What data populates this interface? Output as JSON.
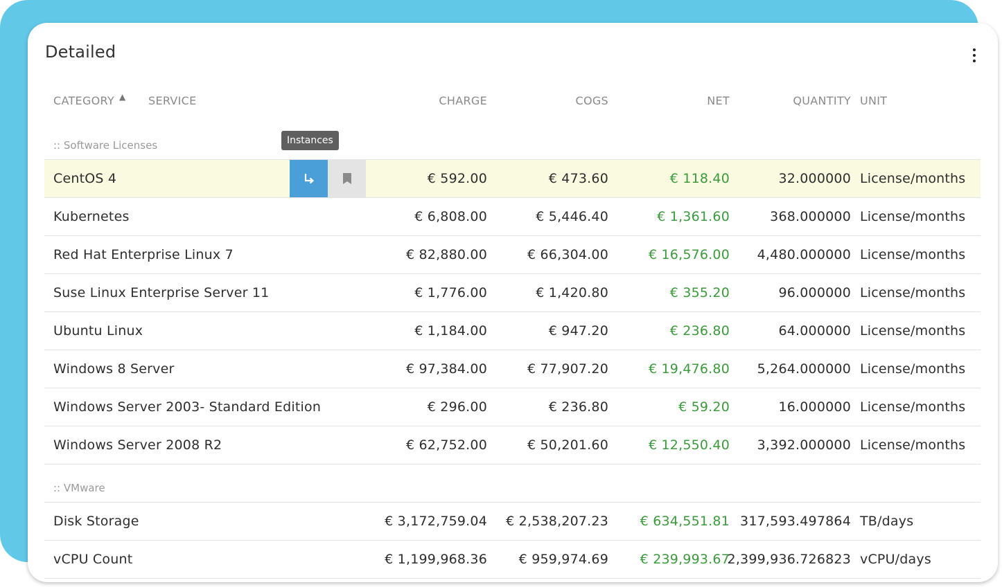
{
  "card": {
    "title": "Detailed"
  },
  "columns": {
    "category": "CATEGORY",
    "service": "SERVICE",
    "charge": "CHARGE",
    "cogs": "COGS",
    "net": "NET",
    "quantity": "QUANTITY",
    "unit": "UNIT"
  },
  "sort": {
    "column": "category",
    "direction": "ascending",
    "icon": "sort-up-icon"
  },
  "tooltip": {
    "text": "Instances"
  },
  "row_actions": {
    "instances_icon": "arrow-return-icon",
    "bookmark_icon": "bookmark-icon"
  },
  "colors": {
    "accent": "#4a9fd8",
    "net_positive": "#3b9a3b",
    "background_band": "#62c8e8",
    "highlight_row": "#fafae0"
  },
  "groups": [
    {
      "label": ":: Software Licenses",
      "rows": [
        {
          "service": "CentOS 4",
          "charge": "€ 592.00",
          "cogs": "€ 473.60",
          "net": "€ 118.40",
          "quantity": "32.000000",
          "unit": "License/months"
        },
        {
          "service": "Kubernetes",
          "charge": "€ 6,808.00",
          "cogs": "€ 5,446.40",
          "net": "€ 1,361.60",
          "quantity": "368.000000",
          "unit": "License/months"
        },
        {
          "service": "Red Hat Enterprise Linux 7",
          "charge": "€ 82,880.00",
          "cogs": "€ 66,304.00",
          "net": "€ 16,576.00",
          "quantity": "4,480.000000",
          "unit": "License/months"
        },
        {
          "service": "Suse Linux Enterprise Server 11",
          "charge": "€ 1,776.00",
          "cogs": "€ 1,420.80",
          "net": "€ 355.20",
          "quantity": "96.000000",
          "unit": "License/months"
        },
        {
          "service": "Ubuntu Linux",
          "charge": "€ 1,184.00",
          "cogs": "€ 947.20",
          "net": "€ 236.80",
          "quantity": "64.000000",
          "unit": "License/months"
        },
        {
          "service": "Windows 8 Server",
          "charge": "€ 97,384.00",
          "cogs": "€ 77,907.20",
          "net": "€ 19,476.80",
          "quantity": "5,264.000000",
          "unit": "License/months"
        },
        {
          "service": "Windows Server 2003- Standard Edition",
          "charge": "€ 296.00",
          "cogs": "€ 236.80",
          "net": "€ 59.20",
          "quantity": "16.000000",
          "unit": "License/months"
        },
        {
          "service": "Windows Server 2008 R2",
          "charge": "€ 62,752.00",
          "cogs": "€ 50,201.60",
          "net": "€ 12,550.40",
          "quantity": "3,392.000000",
          "unit": "License/months"
        }
      ]
    },
    {
      "label": ":: VMware",
      "rows": [
        {
          "service": "Disk Storage",
          "charge": "€ 3,172,759.04",
          "cogs": "€ 2,538,207.23",
          "net": "€ 634,551.81",
          "quantity": "317,593.497864",
          "unit": "TB/days"
        },
        {
          "service": "vCPU Count",
          "charge": "€ 1,199,968.36",
          "cogs": "€ 959,974.69",
          "net": "€ 239,993.67",
          "quantity": "2,399,936.726823",
          "unit": "vCPU/days"
        }
      ]
    }
  ]
}
